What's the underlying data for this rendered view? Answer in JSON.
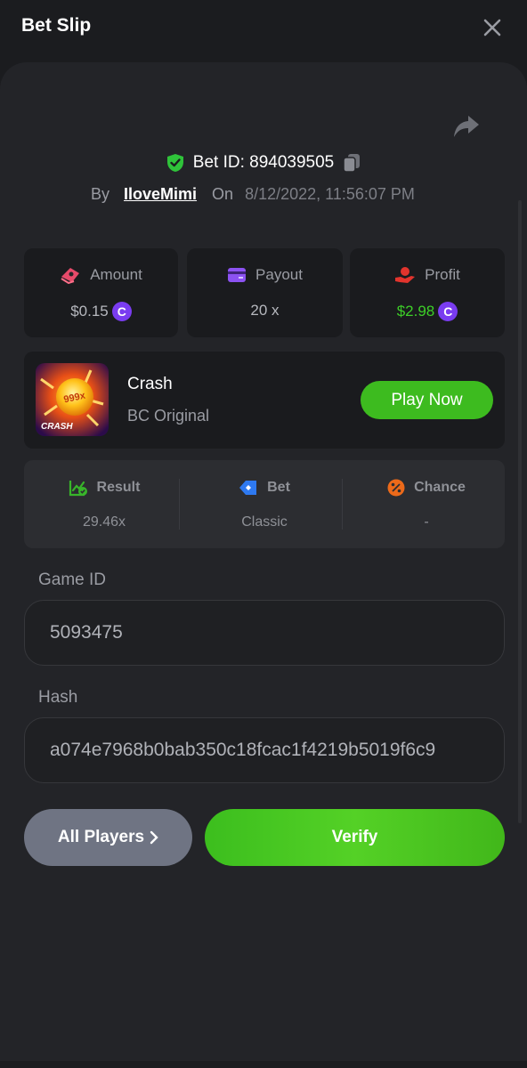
{
  "header": {
    "title": "Bet Slip"
  },
  "bet": {
    "id_text": "Bet ID: 894039505",
    "by_label": "By",
    "username": "IloveMimi",
    "on_label": "On",
    "datetime": "8/12/2022, 11:56:07 PM"
  },
  "stats": [
    {
      "label": "Amount",
      "value": "$0.15",
      "coin": "C",
      "value_color": "#b6b8be"
    },
    {
      "label": "Payout",
      "value": "20 x"
    },
    {
      "label": "Profit",
      "value": "$2.98",
      "coin": "C",
      "value_color": "#3dcf28"
    }
  ],
  "game": {
    "name": "Crash",
    "provider": "BC Original",
    "play_label": "Play Now",
    "thumb_badge": "999x",
    "thumb_text": "CRASH"
  },
  "result_row": {
    "result": {
      "label": "Result",
      "value": "29.46x"
    },
    "bet": {
      "label": "Bet",
      "value": "Classic"
    },
    "chance": {
      "label": "Chance",
      "value": "-"
    }
  },
  "fields": {
    "game_id": {
      "label": "Game ID",
      "value": "5093475"
    },
    "hash": {
      "label": "Hash",
      "value": "a074e7968b0bab350c18fcac1f4219b5019f6c9"
    }
  },
  "actions": {
    "players_label": "All Players",
    "verify_label": "Verify"
  },
  "colors": {
    "accent_green": "#3dbb1f",
    "coin_purple": "#7a3cf0",
    "profit_green": "#3dcf28"
  }
}
